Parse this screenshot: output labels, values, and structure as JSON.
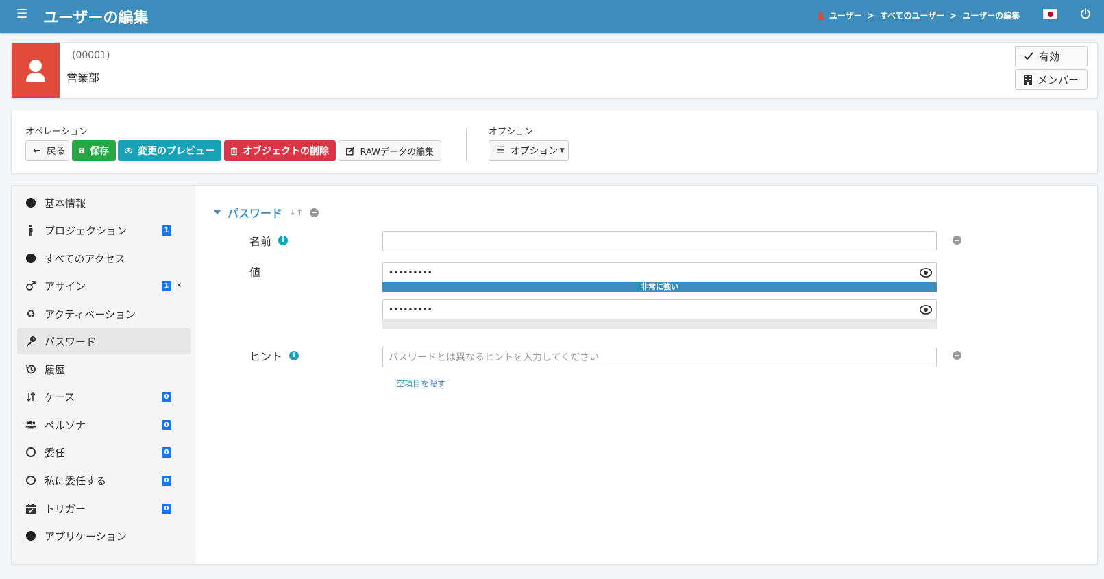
{
  "header": {
    "title": "ユーザーの編集",
    "breadcrumb": [
      "ユーザー",
      "すべてのユーザー",
      "ユーザーの編集"
    ],
    "breadcrumb_sep": ">"
  },
  "user": {
    "id": "(00001)",
    "department": "営業部",
    "status_label": "有効",
    "member_label": "メンバー"
  },
  "operations": {
    "label": "オペレーション",
    "back": "戻る",
    "save": "保存",
    "preview": "変更のプレビュー",
    "delete": "オブジェクトの削除",
    "raw_edit": "RAWデータの編集",
    "options_label": "オプション",
    "options_button": "オプション"
  },
  "sidebar": {
    "items": [
      {
        "label": "基本情報",
        "icon": "circle-filled-icon"
      },
      {
        "label": "プロジェクション",
        "icon": "person-standing-icon",
        "badge": "1"
      },
      {
        "label": "すべてのアクセス",
        "icon": "circle-filled-icon"
      },
      {
        "label": "アサイン",
        "icon": "male-icon",
        "badge": "1"
      },
      {
        "label": "アクティベーション",
        "icon": "recycle-icon"
      },
      {
        "label": "パスワード",
        "icon": "key-icon",
        "active": true
      },
      {
        "label": "履歴",
        "icon": "history-icon"
      },
      {
        "label": "ケース",
        "icon": "sort-arrows-icon",
        "badge": "0"
      },
      {
        "label": "ペルソナ",
        "icon": "users-icon",
        "badge": "0"
      },
      {
        "label": "委任",
        "icon": "circle-hollow-icon",
        "badge": "0"
      },
      {
        "label": "私に委任する",
        "icon": "circle-hollow-icon",
        "badge": "0"
      },
      {
        "label": "トリガー",
        "icon": "calendar-check-icon",
        "badge": "0"
      },
      {
        "label": "アプリケーション",
        "icon": "circle-filled-icon"
      }
    ]
  },
  "password_section": {
    "title": "パスワード",
    "name_label": "名前",
    "name_value": "",
    "value_label": "値",
    "password_value": "•••••••••",
    "confirm_value": "•••••••••",
    "strength_text": "非常に強い",
    "hint_label": "ヒント",
    "hint_placeholder": "パスワードとは異なるヒントを入力してください",
    "hide_empty": "空項目を隠す"
  },
  "colors": {
    "header": "#3c8dbc",
    "avatar": "#e24b3b",
    "save": "#28a745",
    "preview": "#17a2b8",
    "delete": "#dc3545",
    "badge": "#1a73e8"
  }
}
